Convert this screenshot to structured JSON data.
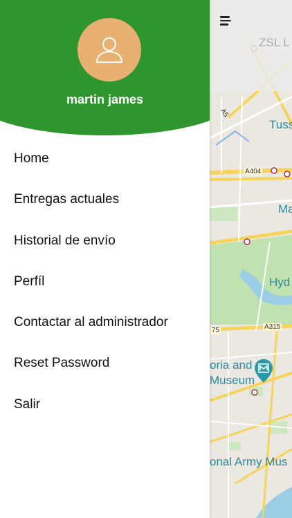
{
  "user": {
    "name": "martin james"
  },
  "menu": {
    "items": [
      {
        "label": "Home"
      },
      {
        "label": "Entregas actuales"
      },
      {
        "label": "Historial de envío"
      },
      {
        "label": "Perfíl"
      },
      {
        "label": "Contactar al administrador"
      },
      {
        "label": "Reset Password"
      },
      {
        "label": "Salir"
      }
    ]
  },
  "map": {
    "labels": {
      "zsl": "ZSL L",
      "tuss": "Tuss",
      "ma": "Ma",
      "hyd": "Hyd",
      "museum_line1": "oria and",
      "museum_line2": "Museum",
      "army": "onal Army Mus"
    },
    "roads": {
      "a5": "A5",
      "a404": "A404",
      "a315": "A315",
      "r75": "75"
    }
  },
  "colors": {
    "header_green": "#2f962f",
    "avatar_bg": "#e8b071",
    "map_water": "#9ccde6",
    "map_park": "#bfe2b0",
    "map_road_major": "#f6d45a"
  },
  "icons": {
    "avatar": "person-outline-icon",
    "menu": "hamburger-icon",
    "museum": "museum-pin-icon"
  }
}
